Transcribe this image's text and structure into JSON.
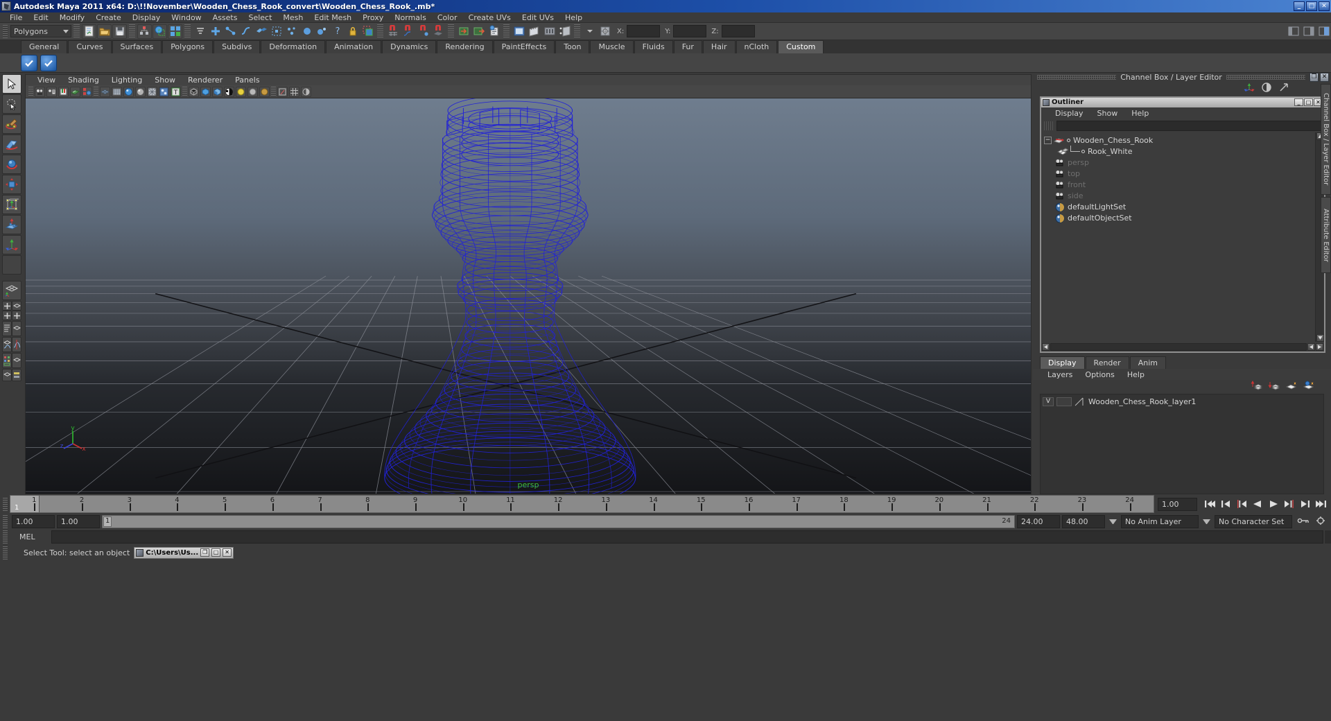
{
  "window": {
    "title": "Autodesk Maya 2011 x64: D:\\!!November\\Wooden_Chess_Rook_convert\\Wooden_Chess_Rook_.mb*",
    "minimize": "_",
    "maximize": "□",
    "close": "✕"
  },
  "menubar": {
    "items": [
      "File",
      "Edit",
      "Modify",
      "Create",
      "Display",
      "Window",
      "Assets",
      "Select",
      "Mesh",
      "Edit Mesh",
      "Proxy",
      "Normals",
      "Color",
      "Create UVs",
      "Edit UVs",
      "Help"
    ]
  },
  "statusline": {
    "mode_selected": "Polygons",
    "coord_labels": [
      "X:",
      "Y:",
      "Z:"
    ],
    "coord_values": [
      "",
      "",
      ""
    ]
  },
  "shelf": {
    "tabs": [
      "General",
      "Curves",
      "Surfaces",
      "Polygons",
      "Subdivs",
      "Deformation",
      "Animation",
      "Dynamics",
      "Rendering",
      "PaintEffects",
      "Toon",
      "Muscle",
      "Fluids",
      "Fur",
      "Hair",
      "nCloth",
      "Custom"
    ],
    "active_tab": "Custom",
    "buttons": [
      "check-blue-1",
      "check-blue-2"
    ]
  },
  "viewport": {
    "menu": [
      "View",
      "Shading",
      "Lighting",
      "Show",
      "Renderer",
      "Panels"
    ],
    "camera_label": "persp",
    "axis": {
      "x": "x",
      "y": "y",
      "z": "z"
    },
    "wireframe_color": "#2323d8",
    "grid_color": "#9a9a9a"
  },
  "channelbox": {
    "title": "Channel Box / Layer Editor",
    "restore": "❐",
    "close": "✕",
    "vertical_tabs": [
      "Channel Box / Layer Editor",
      "Attribute Editor"
    ]
  },
  "outliner": {
    "title": "Outliner",
    "min": "_",
    "max": "□",
    "close": "✕",
    "menu": [
      "Display",
      "Show",
      "Help"
    ],
    "search_value": "",
    "items": [
      {
        "label": "Wooden_Chess_Rook",
        "icon": "transform-icon",
        "dim": false,
        "indent": 0,
        "expander": "−"
      },
      {
        "label": "Rook_White",
        "icon": "mesh-icon",
        "dim": false,
        "indent": 1,
        "expander": ""
      },
      {
        "label": "persp",
        "icon": "camera-icon",
        "dim": true,
        "indent": 0,
        "expander": ""
      },
      {
        "label": "top",
        "icon": "camera-icon",
        "dim": true,
        "indent": 0,
        "expander": ""
      },
      {
        "label": "front",
        "icon": "camera-icon",
        "dim": true,
        "indent": 0,
        "expander": ""
      },
      {
        "label": "side",
        "icon": "camera-icon",
        "dim": true,
        "indent": 0,
        "expander": ""
      },
      {
        "label": "defaultLightSet",
        "icon": "set-icon",
        "dim": false,
        "indent": 0,
        "expander": ""
      },
      {
        "label": "defaultObjectSet",
        "icon": "set-icon",
        "dim": false,
        "indent": 0,
        "expander": ""
      }
    ]
  },
  "layer_editor": {
    "tabs": [
      "Display",
      "Render",
      "Anim"
    ],
    "active_tab": "Display",
    "menu": [
      "Layers",
      "Options",
      "Help"
    ],
    "toolbar_icons": [
      "layer-up-icon",
      "layer-down-icon",
      "new-layer-icon",
      "new-layer-from-selection-icon"
    ],
    "layers": [
      {
        "visibility": "V",
        "playback": "",
        "name": "Wooden_Chess_Rook_layer1"
      }
    ]
  },
  "timeslider": {
    "ticks": [
      "1",
      "2",
      "3",
      "4",
      "5",
      "6",
      "7",
      "8",
      "9",
      "10",
      "11",
      "12",
      "13",
      "14",
      "15",
      "16",
      "17",
      "18",
      "19",
      "20",
      "21",
      "22",
      "23",
      "24"
    ],
    "current_frame_label": "1",
    "current_time_field": "1.00",
    "playback_buttons": [
      "go-to-start-icon",
      "step-back-frame-icon",
      "step-back-key-icon",
      "play-backwards-icon",
      "play-forwards-icon",
      "step-forward-key-icon",
      "step-forward-frame-icon",
      "go-to-end-icon"
    ]
  },
  "rangeslider": {
    "anim_start": "1.00",
    "range_start": "1.00",
    "range_bar_left": "1",
    "range_bar_right": "24",
    "range_end": "24.00",
    "anim_end": "48.00",
    "anim_layer": "No Anim Layer",
    "character_set": "No Character Set"
  },
  "command_line": {
    "language_label": "MEL",
    "command_value": ""
  },
  "statusbar": {
    "help_text": "Select Tool: select an object",
    "taskbar_item": "C:\\Users\\Us...",
    "taskbar_buttons": [
      "❐",
      "□",
      "✕"
    ]
  },
  "toolbox": {
    "tools": [
      "select-tool",
      "lasso-select-tool",
      "paint-select-tool",
      "move-tool",
      "rotate-tool",
      "scale-tool",
      "universal-manipulator",
      "soft-modification-tool",
      "last-tool-used",
      "blank-slot"
    ],
    "layouts": [
      "single-perspective-view",
      "four-view-layout",
      "outliner-persp-layout",
      "persp-graph-layout",
      "hypershade-persp-layout",
      "persp-multi-layout"
    ]
  }
}
